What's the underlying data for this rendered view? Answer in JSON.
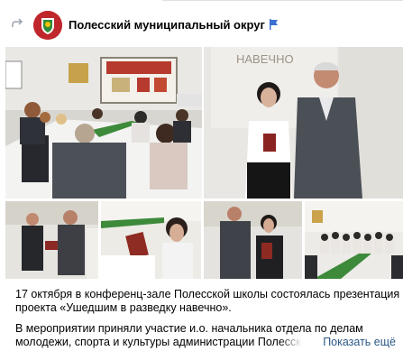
{
  "post": {
    "group_name": "Полесский муниципальный округ",
    "icons": {
      "repost": "repost-arrow-icon",
      "flag": "flag-icon",
      "avatar": "coat-of-arms-avatar"
    },
    "photos": [
      {
        "name": "conference-hall-photo"
      },
      {
        "name": "award-presentation-photo",
        "sign_text": "НАВЕЧНО"
      },
      {
        "name": "handshake-photo"
      },
      {
        "name": "book-reading-photo"
      },
      {
        "name": "book-holding-photo"
      },
      {
        "name": "audience-photo"
      }
    ],
    "text": {
      "paragraph1": "17 октября в конференц-зале Полесской школы состоялась презентация проекта «Ушедшим в разведку навечно».",
      "paragraph2_line1": "В мероприятии приняли участие и.о. начальника отдела по делам",
      "paragraph2_line2": "молодежи, спорта и культуры администрации Полесского округа"
    },
    "show_more_label": "Показать ещё",
    "colors": {
      "link": "#2a5885",
      "muted_icon": "#99a2ad",
      "flag": "#3b6fd1"
    }
  }
}
